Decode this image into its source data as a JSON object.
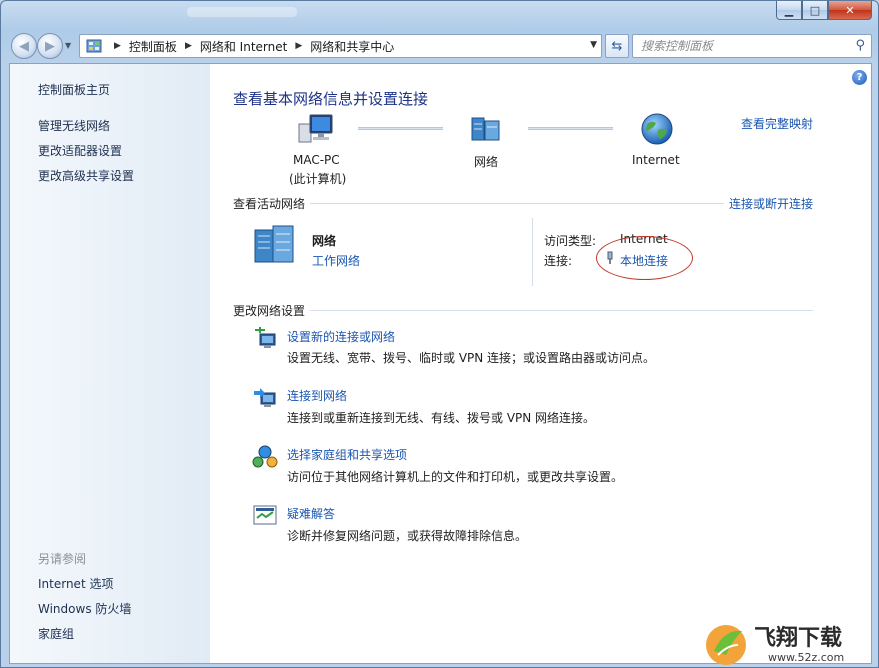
{
  "window": {
    "caption_buttons": [
      "minimize",
      "maximize",
      "close"
    ]
  },
  "address_bar": {
    "crumbs": [
      "控制面板",
      "网络和 Internet",
      "网络和共享中心"
    ]
  },
  "search": {
    "placeholder": "搜索控制面板"
  },
  "sidebar": {
    "items": [
      {
        "label": "控制面板主页"
      },
      {
        "label": "管理无线网络"
      },
      {
        "label": "更改适配器设置"
      },
      {
        "label": "更改高级共享设置"
      }
    ],
    "see_also_heading": "另请参阅",
    "see_also": [
      {
        "label": "Internet 选项"
      },
      {
        "label": "Windows 防火墙"
      },
      {
        "label": "家庭组"
      }
    ]
  },
  "main": {
    "title": "查看基本网络信息并设置连接",
    "view_full_map": "查看完整映射",
    "map": {
      "computer_name": "MAC-PC",
      "computer_sub": "(此计算机)",
      "network": "网络",
      "internet": "Internet"
    },
    "active_networks": {
      "heading": "查看活动网络",
      "connect_disconnect": "连接或断开连接",
      "network_name": "网络",
      "network_type": "工作网络",
      "access_type_label": "访问类型:",
      "access_type_value": "Internet",
      "connections_label": "连接:",
      "connection_value": "本地连接"
    },
    "change_settings": {
      "heading": "更改网络设置",
      "tasks": [
        {
          "title": "设置新的连接或网络",
          "desc": "设置无线、宽带、拨号、临时或 VPN 连接；或设置路由器或访问点。"
        },
        {
          "title": "连接到网络",
          "desc": "连接到或重新连接到无线、有线、拨号或 VPN 网络连接。"
        },
        {
          "title": "选择家庭组和共享选项",
          "desc": "访问位于其他网络计算机上的文件和打印机，或更改共享设置。"
        },
        {
          "title": "疑难解答",
          "desc": "诊断并修复网络问题，或获得故障排除信息。"
        }
      ]
    }
  },
  "watermark": {
    "brand": "飞翔下载",
    "url": "www.52z.com"
  },
  "colors": {
    "link": "#1b56b0",
    "title": "#1e3287",
    "annotation": "#c0392b"
  }
}
